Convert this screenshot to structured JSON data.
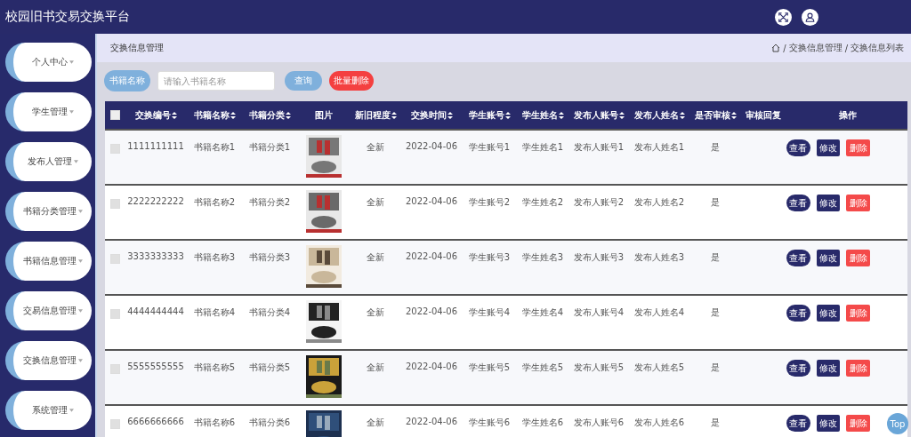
{
  "app_title": "校园旧书交易交换平台",
  "sidebar": {
    "items": [
      {
        "label": "个人中心"
      },
      {
        "label": "学生管理"
      },
      {
        "label": "发布人管理"
      },
      {
        "label": "书籍分类管理"
      },
      {
        "label": "书籍信息管理"
      },
      {
        "label": "交易信息管理"
      },
      {
        "label": "交换信息管理"
      },
      {
        "label": "系统管理"
      }
    ]
  },
  "page_title": "交换信息管理",
  "breadcrumb": [
    {
      "separator": "/",
      "label": "交换信息管理"
    },
    {
      "separator": "/",
      "label": "交换信息列表"
    }
  ],
  "search": {
    "label": "书籍名称",
    "placeholder": "请输入书籍名称",
    "query_button": "查询",
    "batch_delete_button": "批量删除"
  },
  "table": {
    "select_all_checked": false,
    "columns": [
      {
        "label": "交换编号",
        "sortable": true
      },
      {
        "label": "书籍名称",
        "sortable": true
      },
      {
        "label": "书籍分类",
        "sortable": true
      },
      {
        "label": "图片",
        "sortable": false
      },
      {
        "label": "新旧程度",
        "sortable": true
      },
      {
        "label": "交换时间",
        "sortable": true
      },
      {
        "label": "学生账号",
        "sortable": true
      },
      {
        "label": "学生姓名",
        "sortable": true
      },
      {
        "label": "发布人账号",
        "sortable": true
      },
      {
        "label": "发布人姓名",
        "sortable": true
      },
      {
        "label": "是否审核",
        "sortable": true
      },
      {
        "label": "审核回复",
        "sortable": false
      },
      {
        "label": "操作",
        "sortable": false
      }
    ],
    "rows": [
      {
        "checked": false,
        "cells": [
          "1111111111",
          "书籍名称1",
          "书籍分类1",
          {
            "kind": "picture"
          },
          "全新",
          "2022-04-06",
          "学生账号1",
          "学生姓名1",
          "发布人账号1",
          "发布人姓名1",
          "是"
        ],
        "actions": [
          "查看",
          "修改",
          "删除"
        ]
      },
      {
        "checked": false,
        "cells": [
          "2222222222",
          "书籍名称2",
          "书籍分类2",
          {
            "kind": "picture"
          },
          "全新",
          "2022-04-06",
          "学生账号2",
          "学生姓名2",
          "发布人账号2",
          "发布人姓名2",
          "是"
        ],
        "actions": [
          "查看",
          "修改",
          "删除"
        ]
      },
      {
        "checked": false,
        "cells": [
          "3333333333",
          "书籍名称3",
          "书籍分类3",
          {
            "kind": "picture"
          },
          "全新",
          "2022-04-06",
          "学生账号3",
          "学生姓名3",
          "发布人账号3",
          "发布人姓名3",
          "是"
        ],
        "actions": [
          "查看",
          "修改",
          "删除"
        ]
      },
      {
        "checked": false,
        "cells": [
          "4444444444",
          "书籍名称4",
          "书籍分类4",
          {
            "kind": "picture"
          },
          "全新",
          "2022-04-06",
          "学生账号4",
          "学生姓名4",
          "发布人账号4",
          "发布人姓名4",
          "是"
        ],
        "actions": [
          "查看",
          "修改",
          "删除"
        ]
      },
      {
        "checked": false,
        "cells": [
          "5555555555",
          "书籍名称5",
          "书籍分类5",
          {
            "kind": "picture"
          },
          "全新",
          "2022-04-06",
          "学生账号5",
          "学生姓名5",
          "发布人账号5",
          "发布人姓名5",
          "是"
        ],
        "actions": [
          "查看",
          "修改",
          "删除"
        ]
      },
      {
        "checked": false,
        "cells": [
          "6666666666",
          "书籍名称6",
          "书籍分类6",
          {
            "kind": "picture"
          },
          "全新",
          "2022-04-06",
          "学生账号6",
          "学生姓名6",
          "发布人账号6",
          "发布人姓名6",
          "是"
        ],
        "actions": [
          "查看",
          "修改",
          "删除"
        ]
      }
    ]
  },
  "back_to_top": "Top"
}
